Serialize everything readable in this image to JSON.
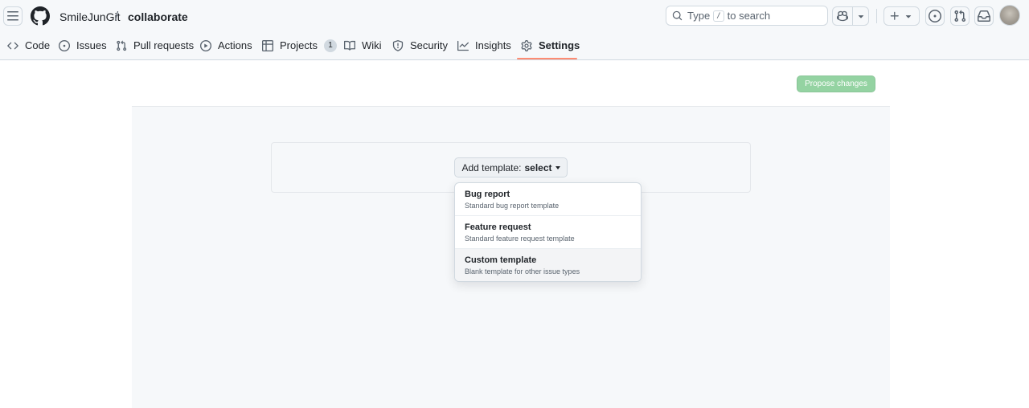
{
  "header": {
    "owner": "SmileJunGit",
    "separator": "/",
    "repo": "collaborate",
    "search": {
      "prefix": "Type",
      "key": "/",
      "suffix": "to search"
    }
  },
  "tabs": [
    {
      "label": "Code",
      "icon": "code-icon"
    },
    {
      "label": "Issues",
      "icon": "issue-icon"
    },
    {
      "label": "Pull requests",
      "icon": "pull-request-icon"
    },
    {
      "label": "Actions",
      "icon": "play-icon"
    },
    {
      "label": "Projects",
      "icon": "table-icon",
      "counter": "1"
    },
    {
      "label": "Wiki",
      "icon": "book-icon"
    },
    {
      "label": "Security",
      "icon": "shield-icon"
    },
    {
      "label": "Insights",
      "icon": "graph-icon"
    },
    {
      "label": "Settings",
      "icon": "gear-icon",
      "selected": true
    }
  ],
  "actions": {
    "propose_label": "Propose changes"
  },
  "template_select": {
    "label": "Add template:",
    "value": "select",
    "options": [
      {
        "title": "Bug report",
        "description": "Standard bug report template"
      },
      {
        "title": "Feature request",
        "description": "Standard feature request template"
      },
      {
        "title": "Custom template",
        "description": "Blank template for other issue types",
        "highlighted": true
      }
    ]
  },
  "colors": {
    "accent_underline": "#fd8c73",
    "propose_button": "#94d3a2",
    "header_bg": "#f6f8fa"
  }
}
